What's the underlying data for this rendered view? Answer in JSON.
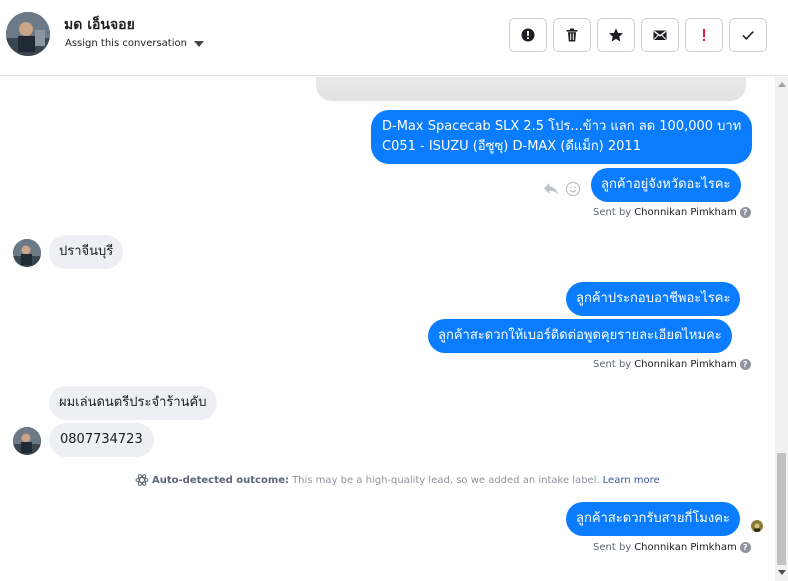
{
  "header": {
    "contact_name": "มด เอ็นจอย",
    "assign_label": "Assign this conversation",
    "actions": [
      {
        "icon": "exclamation-circle-icon",
        "label": "Mark as spam"
      },
      {
        "icon": "trash-icon",
        "label": "Delete"
      },
      {
        "icon": "star-icon",
        "label": "Star"
      },
      {
        "icon": "envelope-icon",
        "label": "Mark as unread"
      },
      {
        "icon": "exclamation-mark-icon",
        "label": "Follow up"
      },
      {
        "icon": "checkmark-icon",
        "label": "Done"
      }
    ]
  },
  "messages": {
    "m1_line1": "D-Max Spacecab SLX 2.5 โปร...ข้าว แลก ลด 100,000 บาท",
    "m1_line2": "C051 - ISUZU (อีซูซุ) D-MAX (ดีแม็ก) 2011",
    "m2": "ลูกค้าอยู่จังหวัดอะไรคะ",
    "sent_by_1_prefix": "Sent by",
    "sent_by_1_name": "Chonnikan Pimkham",
    "m3": "ปราจีนบุรี",
    "m4": "ลูกค้าประกอบอาชีพอะไรคะ",
    "m5": "ลูกค้าสะดวกให้เบอร์ติดต่อพูดคุยรายละเอียดไหมคะ",
    "sent_by_2_prefix": "Sent by",
    "sent_by_2_name": "Chonnikan Pimkham",
    "m6": "ผมเล่นดนตรีประจำร้านคับ",
    "m7": "0807734723",
    "auto_title": "Auto-detected outcome:",
    "auto_text": "This may be a high-quality lead, so we added an intake label.",
    "auto_link": "Learn more",
    "m8": "ลูกค้าสะดวกรับสายกี่โมงคะ",
    "sent_by_3_prefix": "Sent by",
    "sent_by_3_name": "Chonnikan Pimkham",
    "help_glyph": "?"
  },
  "colors": {
    "outgoing_bubble": "#0a7cff",
    "incoming_bubble": "#eeeff2",
    "link": "#385898",
    "follow_up_red": "#e41e3f"
  }
}
